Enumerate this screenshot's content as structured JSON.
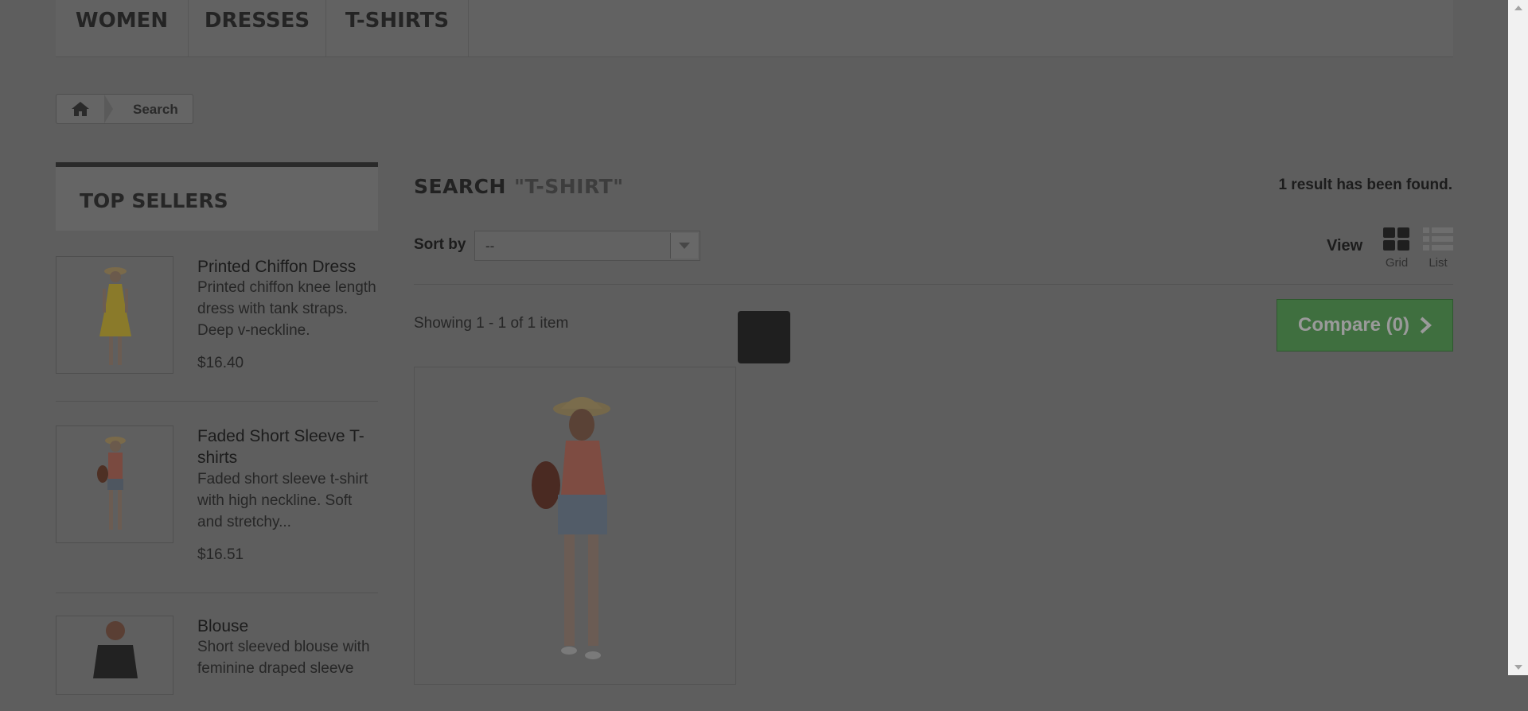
{
  "nav": {
    "items": [
      {
        "label": "WOMEN"
      },
      {
        "label": "DRESSES"
      },
      {
        "label": "T-SHIRTS"
      }
    ]
  },
  "breadcrumb": {
    "home_icon": "home-icon",
    "current": "Search"
  },
  "sidebar": {
    "title": "TOP SELLERS",
    "products": [
      {
        "name": "Printed Chiffon Dress",
        "description": "Printed chiffon knee length dress with tank straps. Deep v-neckline.",
        "price": "$16.40"
      },
      {
        "name": "Faded Short Sleeve T-shirts",
        "description": "Faded short sleeve t-shirt with high neckline. Soft and stretchy...",
        "price": "$16.51"
      },
      {
        "name": "Blouse",
        "description": "Short sleeved blouse with feminine draped sleeve"
      }
    ]
  },
  "search": {
    "heading": "SEARCH",
    "query": "\"T-SHIRT\"",
    "result_count": "1 result has been found."
  },
  "toolbar": {
    "sort_label": "Sort by",
    "sort_value": "--",
    "view_label": "View",
    "grid_label": "Grid",
    "list_label": "List"
  },
  "results": {
    "showing": "Showing 1 - 1 of 1 item",
    "compare_label": "Compare (0)"
  },
  "colors": {
    "overlay": "#5e5e5e",
    "compare_button": "#3f6f3f"
  }
}
